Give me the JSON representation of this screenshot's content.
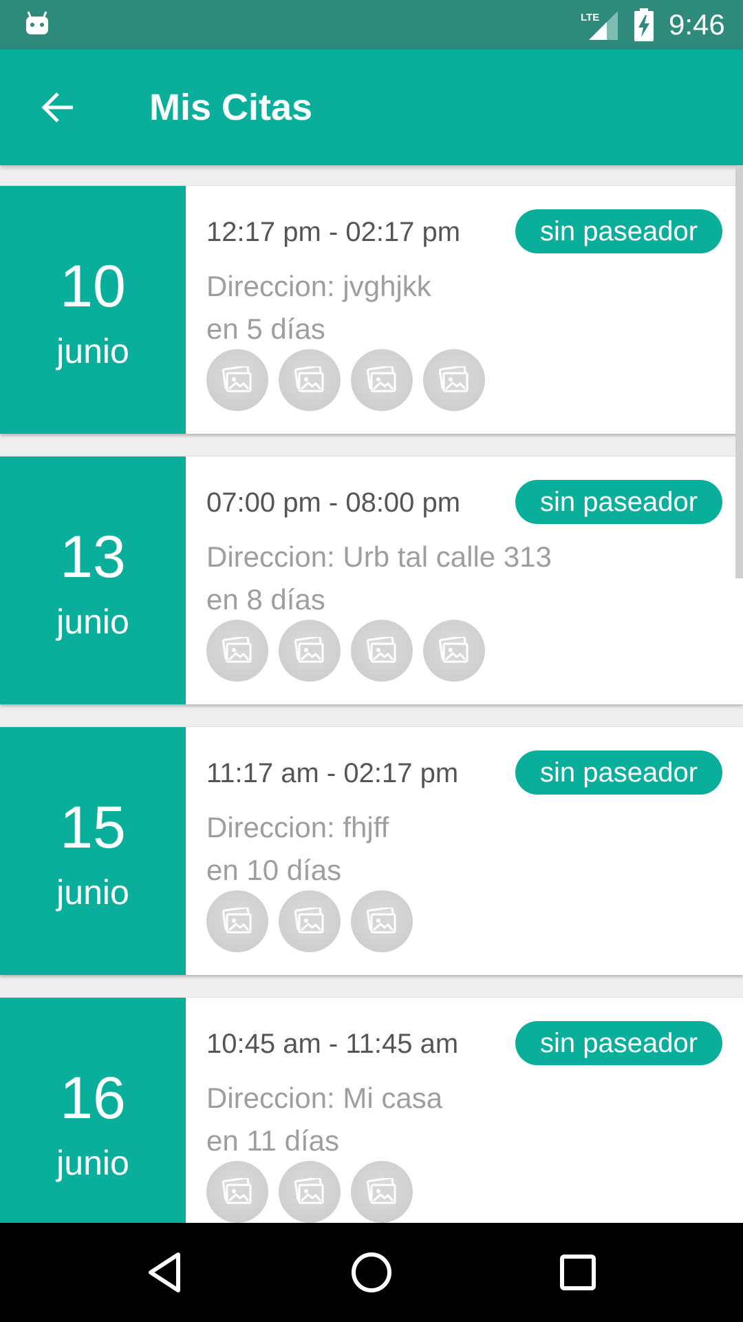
{
  "status_bar": {
    "time": "9:46",
    "network": "LTE",
    "icons": [
      "android-notification-icon",
      "lte-signal-icon",
      "battery-charging-icon"
    ]
  },
  "app_bar": {
    "title": "Mis Citas",
    "back_icon": "arrow-back-icon"
  },
  "colors": {
    "primary": "#0aaf9c",
    "status_bar": "#2e8b7b",
    "text_dark": "#555555",
    "text_muted": "#9e9e9e",
    "placeholder": "#cfcfcf"
  },
  "appointments": [
    {
      "day": "10",
      "month": "junio",
      "time": "12:17 pm - 02:17 pm",
      "status": "sin paseador",
      "address": "Direccion: jvghjkk",
      "days_left": "en 5 días",
      "photos": 4
    },
    {
      "day": "13",
      "month": "junio",
      "time": "07:00 pm - 08:00 pm",
      "status": "sin paseador",
      "address": "Direccion: Urb tal calle 313",
      "days_left": "en 8 días",
      "photos": 4
    },
    {
      "day": "15",
      "month": "junio",
      "time": "11:17 am - 02:17 pm",
      "status": "sin paseador",
      "address": "Direccion: fhjff",
      "days_left": "en 10 días",
      "photos": 3
    },
    {
      "day": "16",
      "month": "junio",
      "time": "10:45 am - 11:45 am",
      "status": "sin paseador",
      "address": "Direccion: Mi casa",
      "days_left": "en 11 días",
      "photos": 3
    }
  ],
  "nav_bar": {
    "icons": [
      "back-triangle-icon",
      "home-circle-icon",
      "recents-square-icon"
    ]
  }
}
